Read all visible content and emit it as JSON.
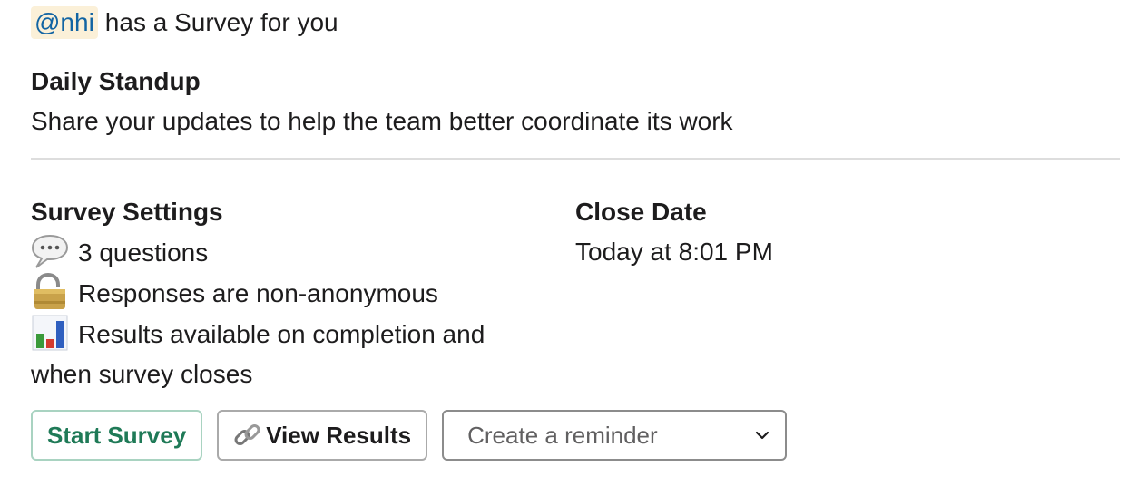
{
  "header": {
    "mention": "@nhi",
    "text": "has a Survey for you"
  },
  "survey": {
    "title": "Daily Standup",
    "description": "Share your updates to help the team better coordinate its work"
  },
  "settings": {
    "label": "Survey Settings",
    "items": [
      {
        "icon": "speech-bubble-icon",
        "text": "3 questions"
      },
      {
        "icon": "padlock-icon",
        "text": "Responses are non-anonymous"
      },
      {
        "icon": "bar-chart-icon",
        "text": "Results available on completion and when survey closes"
      }
    ]
  },
  "close_date": {
    "label": "Close Date",
    "value": "Today at 8:01 PM"
  },
  "actions": {
    "start_label": "Start Survey",
    "view_results_label": "View Results",
    "view_results_icon": "link-icon",
    "reminder_placeholder": "Create a reminder",
    "reminder_icon": "chevron-down-icon"
  }
}
